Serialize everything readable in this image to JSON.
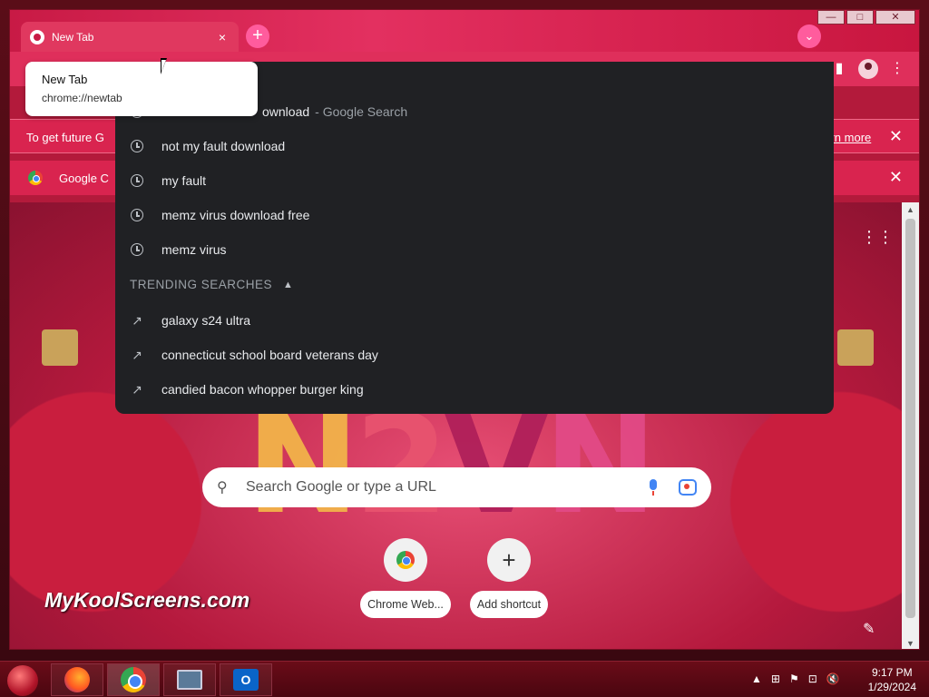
{
  "browser": {
    "tab": {
      "title": "New Tab",
      "close": "×"
    },
    "new_tab_symbol": "+",
    "tab_search_symbol": "⌄",
    "window_controls": {
      "minimize": "—",
      "maximize": "□",
      "close": "✕"
    },
    "hovercard": {
      "title": "New Tab",
      "url": "chrome://newtab"
    },
    "toolbar": {
      "side_panel_icon": "side-panel-icon",
      "profile_icon": "profile-icon",
      "menu_icon": "⋮"
    },
    "infobars": [
      {
        "text": "To get future G",
        "link": "earn more",
        "close": "✕"
      },
      {
        "text": "Google C",
        "close": "✕"
      }
    ]
  },
  "omnibox_dropdown": {
    "top_suggestion": {
      "text": "ownload",
      "suffix": "- Google Search"
    },
    "history": [
      "not my fault download",
      "my fault",
      "memz virus download free",
      "memz virus"
    ],
    "trending_header": "TRENDING SEARCHES",
    "trending": [
      "galaxy s24 ultra",
      "connecticut school board veterans day",
      "candied bacon whopper burger king"
    ]
  },
  "ntp": {
    "logo_text": [
      "N",
      "2",
      "V",
      "N"
    ],
    "search_placeholder": "Search Google or type a URL",
    "shortcuts": [
      {
        "label": "Chrome Web...",
        "icon": "chrome-web-store-icon"
      },
      {
        "label": "Add shortcut",
        "icon": "+"
      }
    ],
    "watermark": "MyKoolScreens.com",
    "customize_icon": "✎"
  },
  "taskbar": {
    "apps": [
      "firefox-icon",
      "chrome-icon",
      "remote-desktop-icon",
      "outlook-icon"
    ],
    "outlook_letter": "O",
    "tray_icons": [
      "▲",
      "⊞",
      "⚑",
      "⊡",
      "🔇"
    ],
    "time": "9:17 PM",
    "date": "1/29/2024"
  },
  "colors": {
    "accent": "#df2f5b",
    "dropdown_bg": "#202124",
    "taskbar": "#5a0a14"
  }
}
